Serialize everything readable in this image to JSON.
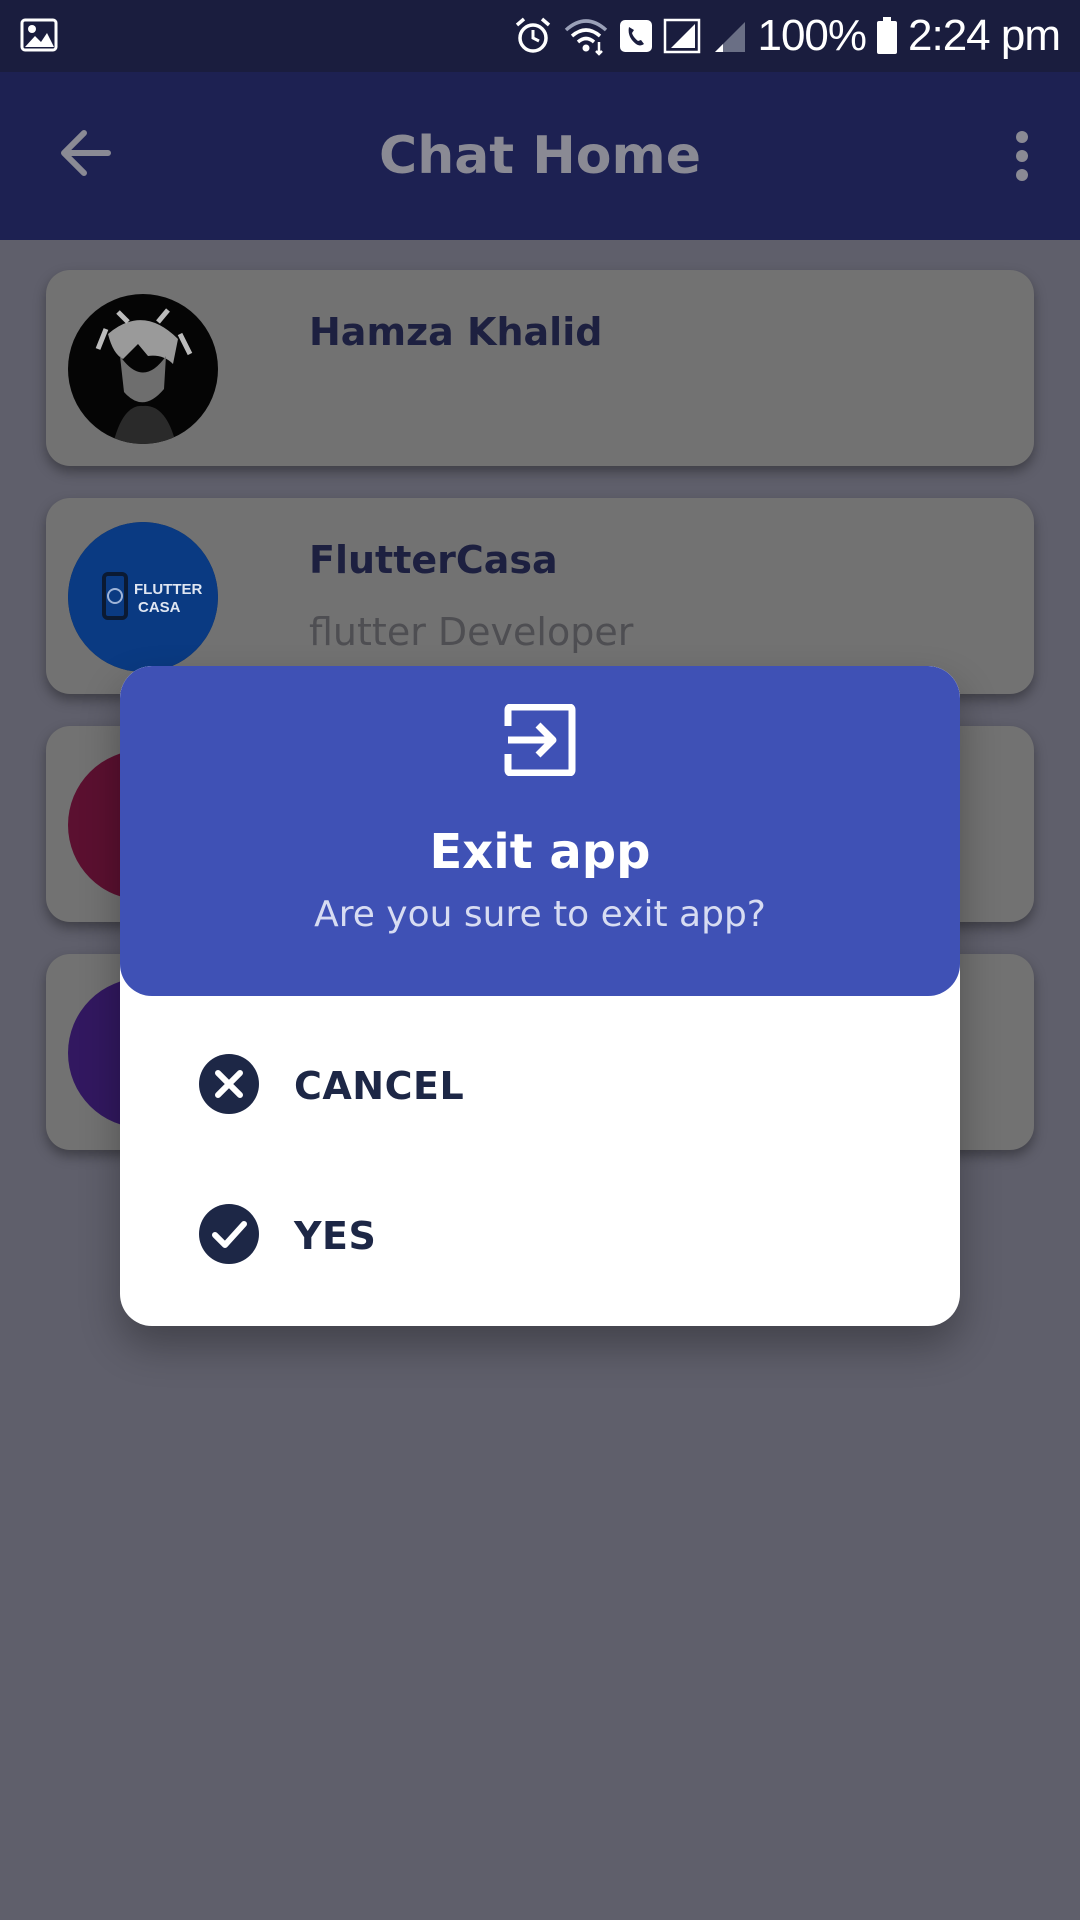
{
  "status_bar": {
    "battery": "100%",
    "time": "2:24 pm"
  },
  "app_bar": {
    "title": "Chat Home",
    "back_icon": "arrow-back-icon",
    "menu_icon": "more-vert-icon"
  },
  "chats": [
    {
      "name": "Hamza Khalid",
      "subtitle": ""
    },
    {
      "name": "FlutterCasa",
      "subtitle": "flutter Developer",
      "avatar_text": [
        "FLUTTER",
        "CASA"
      ]
    }
  ],
  "dialog": {
    "icon": "exit-to-app-icon",
    "title": "Exit app",
    "message": "Are you sure to exit app?",
    "options": [
      {
        "label": "CANCEL",
        "icon": "close-circle-icon"
      },
      {
        "label": "YES",
        "icon": "check-circle-icon"
      }
    ]
  },
  "colors": {
    "dialog_header": "#3f51b5",
    "app_bar": "#1d2152",
    "status_bar": "#1a1d3e",
    "option_text": "#1d2746"
  }
}
